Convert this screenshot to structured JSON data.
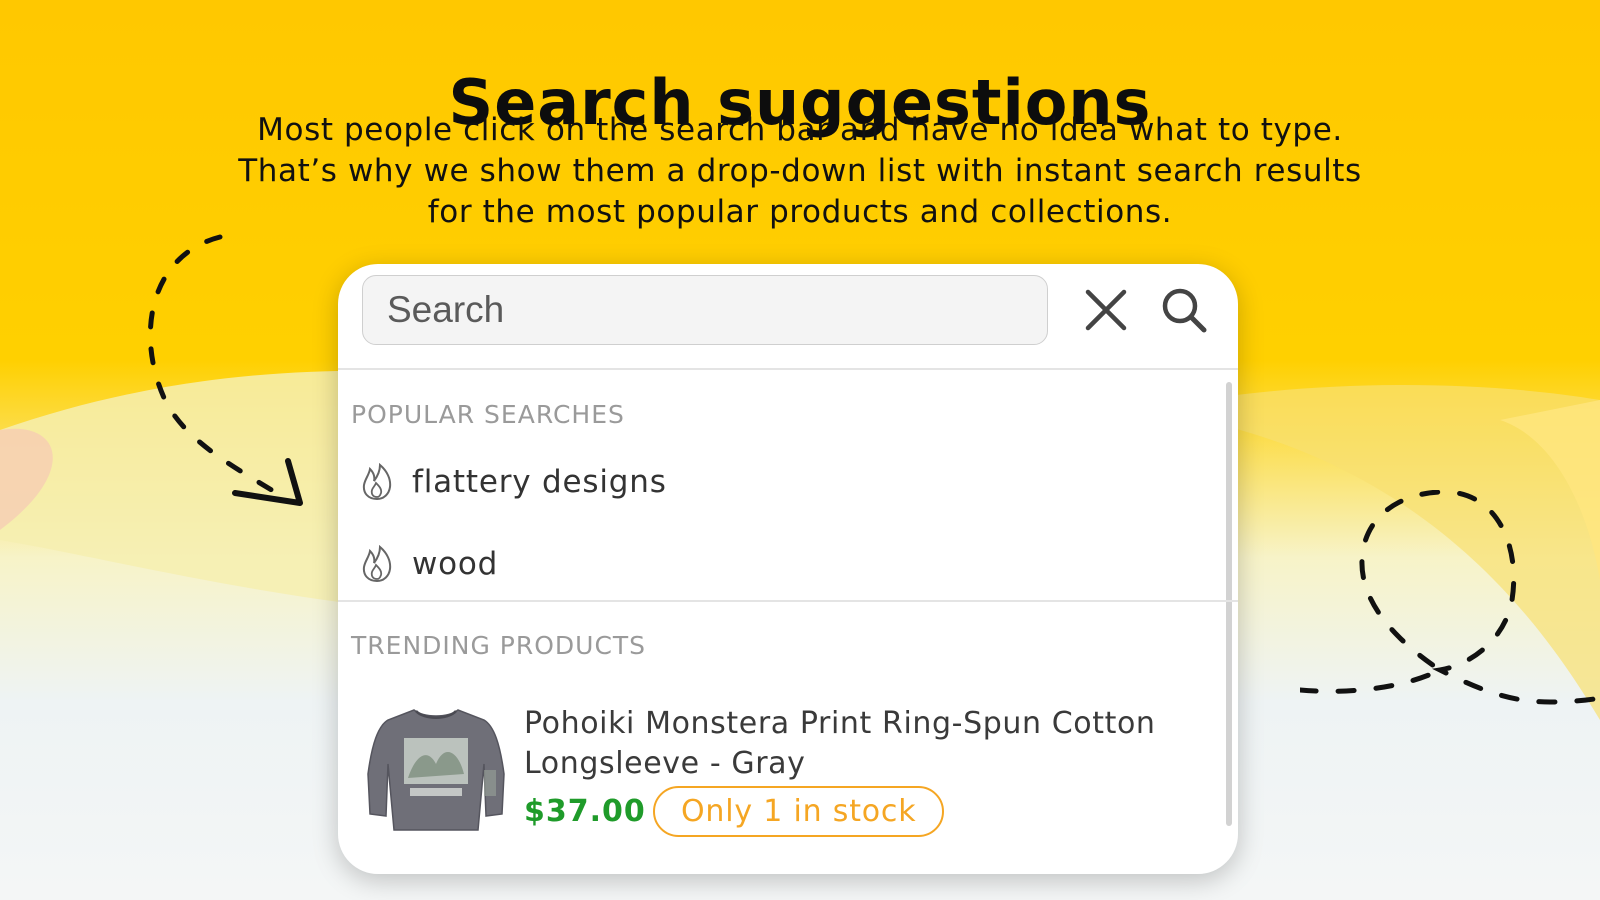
{
  "hero": {
    "title": "Search suggestions",
    "description_lines": [
      "Most people click on the search bar and have no idea what to type.",
      "That’s why we show them a drop-down list with instant search results",
      "for the most popular products and collections."
    ]
  },
  "search": {
    "placeholder": "Search",
    "value": "",
    "close_icon": "close-icon",
    "search_icon": "search-icon"
  },
  "popular_searches": {
    "heading": "POPULAR SEARCHES",
    "icon": "flame-icon",
    "items": [
      {
        "label": "flattery designs"
      },
      {
        "label": "wood"
      }
    ]
  },
  "trending_products": {
    "heading": "TRENDING PRODUCTS",
    "items": [
      {
        "name_lines": [
          "Pohoiki Monstera Print Ring-Spun Cotton",
          "Longsleeve - Gray"
        ],
        "price": "$37.00",
        "stock_badge": "Only 1 in stock",
        "thumbnail_icon": "gray-longsleeve-shirt-image"
      }
    ]
  },
  "colors": {
    "background_accent": "#ffcc00",
    "price": "#1f9b2a",
    "stock_badge": "#f5a623",
    "section_label": "#9a9a9a"
  }
}
